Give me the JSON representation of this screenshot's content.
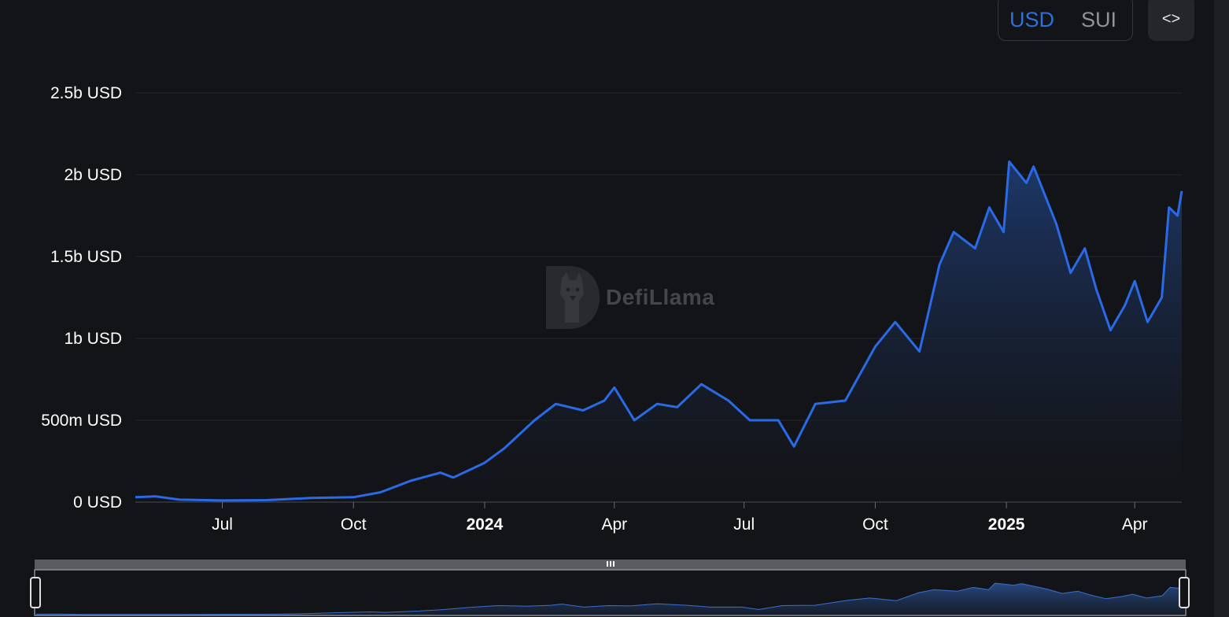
{
  "toggle": {
    "usd_label": "USD",
    "sui_label": "SUI",
    "active": "USD"
  },
  "embed": {
    "icon": "code-icon",
    "label": "<>"
  },
  "watermark": {
    "text": "DefiLlama",
    "icon": "llama-logo-icon"
  },
  "colors": {
    "line": "#2a6ae6",
    "background": "#131417",
    "grid": "#24262b",
    "area_top": "#1e3a6e"
  },
  "chart_data": {
    "type": "area",
    "title": "",
    "xlabel": "",
    "ylabel": "",
    "ylim": [
      0,
      2500000000
    ],
    "yticks": [
      {
        "value": 0,
        "label": "0 USD"
      },
      {
        "value": 500000000,
        "label": "500m USD"
      },
      {
        "value": 1000000000,
        "label": "1b USD"
      },
      {
        "value": 1500000000,
        "label": "1.5b USD"
      },
      {
        "value": 2000000000,
        "label": "2b USD"
      },
      {
        "value": 2500000000,
        "label": "2.5b USD"
      }
    ],
    "xlim": [
      "2023-05-01",
      "2025-05-04"
    ],
    "xticks": [
      {
        "date": "2023-07-01",
        "label": "Jul",
        "bold": false
      },
      {
        "date": "2023-10-01",
        "label": "Oct",
        "bold": false
      },
      {
        "date": "2024-01-01",
        "label": "2024",
        "bold": true
      },
      {
        "date": "2024-04-01",
        "label": "Apr",
        "bold": false
      },
      {
        "date": "2024-07-01",
        "label": "Jul",
        "bold": false
      },
      {
        "date": "2024-10-01",
        "label": "Oct",
        "bold": false
      },
      {
        "date": "2025-01-01",
        "label": "2025",
        "bold": true
      },
      {
        "date": "2025-04-01",
        "label": "Apr",
        "bold": false
      }
    ],
    "grid": true,
    "series": [
      {
        "unit": "USD",
        "points": [
          [
            "2023-05-01",
            30000000
          ],
          [
            "2023-05-15",
            35000000
          ],
          [
            "2023-06-01",
            15000000
          ],
          [
            "2023-07-01",
            10000000
          ],
          [
            "2023-08-01",
            12000000
          ],
          [
            "2023-09-01",
            25000000
          ],
          [
            "2023-10-01",
            30000000
          ],
          [
            "2023-10-20",
            60000000
          ],
          [
            "2023-11-10",
            130000000
          ],
          [
            "2023-12-01",
            180000000
          ],
          [
            "2023-12-10",
            150000000
          ],
          [
            "2024-01-01",
            240000000
          ],
          [
            "2024-01-15",
            330000000
          ],
          [
            "2024-02-05",
            500000000
          ],
          [
            "2024-02-20",
            600000000
          ],
          [
            "2024-03-10",
            560000000
          ],
          [
            "2024-03-25",
            620000000
          ],
          [
            "2024-04-01",
            700000000
          ],
          [
            "2024-04-15",
            500000000
          ],
          [
            "2024-05-01",
            600000000
          ],
          [
            "2024-05-15",
            580000000
          ],
          [
            "2024-06-01",
            720000000
          ],
          [
            "2024-06-20",
            620000000
          ],
          [
            "2024-07-05",
            500000000
          ],
          [
            "2024-07-25",
            500000000
          ],
          [
            "2024-08-05",
            340000000
          ],
          [
            "2024-08-20",
            600000000
          ],
          [
            "2024-09-10",
            620000000
          ],
          [
            "2024-10-01",
            950000000
          ],
          [
            "2024-10-15",
            1100000000
          ],
          [
            "2024-11-01",
            920000000
          ],
          [
            "2024-11-15",
            1450000000
          ],
          [
            "2024-11-25",
            1650000000
          ],
          [
            "2024-12-10",
            1550000000
          ],
          [
            "2024-12-20",
            1800000000
          ],
          [
            "2024-12-30",
            1650000000
          ],
          [
            "2025-01-03",
            2080000000
          ],
          [
            "2025-01-15",
            1950000000
          ],
          [
            "2025-01-20",
            2050000000
          ],
          [
            "2025-02-05",
            1700000000
          ],
          [
            "2025-02-15",
            1400000000
          ],
          [
            "2025-02-25",
            1550000000
          ],
          [
            "2025-03-05",
            1300000000
          ],
          [
            "2025-03-15",
            1050000000
          ],
          [
            "2025-03-25",
            1200000000
          ],
          [
            "2025-04-01",
            1350000000
          ],
          [
            "2025-04-10",
            1100000000
          ],
          [
            "2025-04-20",
            1250000000
          ],
          [
            "2025-04-25",
            1800000000
          ],
          [
            "2025-05-01",
            1750000000
          ],
          [
            "2025-05-04",
            1900000000
          ]
        ]
      }
    ]
  }
}
